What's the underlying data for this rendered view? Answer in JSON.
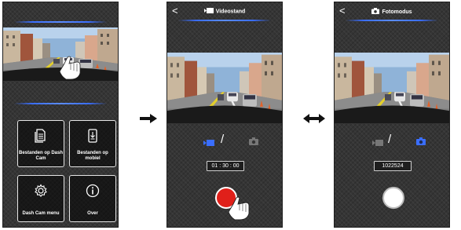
{
  "home": {
    "tiles": [
      {
        "label": "Bestanden op Dash Cam",
        "icon": "document-icon"
      },
      {
        "label": "Bestanden op mobiel",
        "icon": "phone-download-icon"
      },
      {
        "label": "Dash Cam menu",
        "icon": "gear-icon"
      },
      {
        "label": "Over",
        "icon": "info-icon"
      }
    ]
  },
  "video_screen": {
    "back": "<",
    "title": "Videostand",
    "mode_separator": "/",
    "timer": "01 : 30 : 00"
  },
  "photo_screen": {
    "back": "<",
    "title": "Fotomodus",
    "mode_separator": "/",
    "counter": "1022524"
  },
  "colors": {
    "accent": "#3a6eff",
    "record": "#e0201a",
    "panel": "#343434"
  }
}
